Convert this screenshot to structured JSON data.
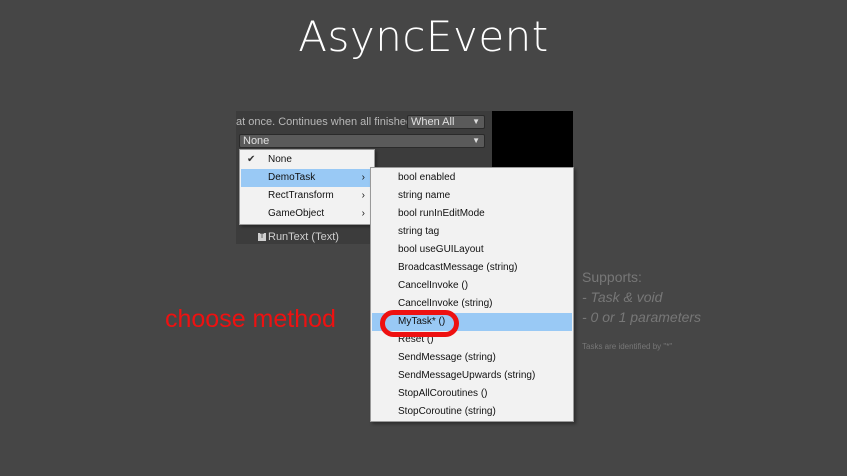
{
  "title": "AsyncEvent",
  "inspector": {
    "description": "at once. Continues when all finished.",
    "mode_dropdown": "When All",
    "target_field": "None",
    "runtext_label": "RunText (Text)"
  },
  "menu_primary": {
    "items": [
      {
        "label": "None",
        "checked": true,
        "submenu": false
      },
      {
        "label": "DemoTask",
        "checked": false,
        "submenu": true,
        "selected": true
      },
      {
        "label": "RectTransform",
        "checked": false,
        "submenu": true
      },
      {
        "label": "GameObject",
        "checked": false,
        "submenu": true
      }
    ]
  },
  "menu_methods": {
    "items": [
      "bool enabled",
      "string name",
      "bool runInEditMode",
      "string tag",
      "bool useGUILayout",
      "BroadcastMessage (string)",
      "CancelInvoke ()",
      "CancelInvoke (string)",
      "MyTask* ()",
      "Reset ()",
      "SendMessage (string)",
      "SendMessageUpwards (string)",
      "StopAllCoroutines ()",
      "StopCoroutine (string)"
    ],
    "selected_index": 8
  },
  "annotation": "choose method",
  "supports": {
    "heading": "Supports:",
    "line1": "- Task & void",
    "line2": "- 0 or 1 parameters"
  },
  "note": "Tasks are identified by \"*\"",
  "colors": {
    "background": "#464646",
    "highlight": "#99c9f5",
    "annotation_red": "#ee1111"
  }
}
